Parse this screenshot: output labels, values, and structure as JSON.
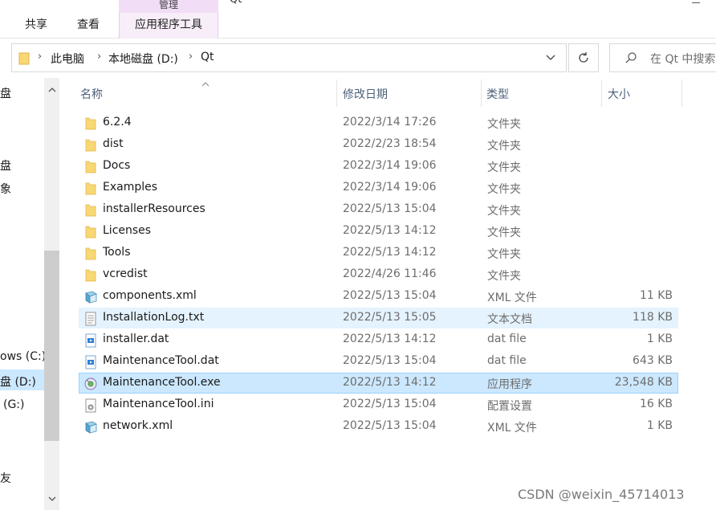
{
  "ribbon": {
    "manage_label": "管理",
    "window_title": "Qt",
    "tabs": [
      {
        "label": "共享"
      },
      {
        "label": "查看"
      },
      {
        "label": "应用程序工具"
      }
    ]
  },
  "address": {
    "crumbs": [
      "此电脑",
      "本地磁盘 (D:)",
      "Qt"
    ],
    "search_placeholder": "在 Qt 中搜索"
  },
  "nav": {
    "items": [
      {
        "label": "盘"
      },
      {
        "label": "盘"
      },
      {
        "label": "象"
      },
      {
        "label": "ows (C:)"
      },
      {
        "label": "盘 (D:)"
      },
      {
        "label": "(G:)"
      },
      {
        "label": "友"
      }
    ]
  },
  "columns": {
    "name": "名称",
    "date": "修改日期",
    "type": "类型",
    "size": "大小"
  },
  "files": [
    {
      "name": "6.2.4",
      "date": "2022/3/14 17:26",
      "type": "文件夹",
      "size": "",
      "icon": "folder-icon"
    },
    {
      "name": "dist",
      "date": "2022/2/23 18:54",
      "type": "文件夹",
      "size": "",
      "icon": "folder-icon"
    },
    {
      "name": "Docs",
      "date": "2022/3/14 19:06",
      "type": "文件夹",
      "size": "",
      "icon": "folder-icon"
    },
    {
      "name": "Examples",
      "date": "2022/3/14 19:06",
      "type": "文件夹",
      "size": "",
      "icon": "folder-icon"
    },
    {
      "name": "installerResources",
      "date": "2022/5/13 15:04",
      "type": "文件夹",
      "size": "",
      "icon": "folder-icon"
    },
    {
      "name": "Licenses",
      "date": "2022/5/13 14:12",
      "type": "文件夹",
      "size": "",
      "icon": "folder-icon"
    },
    {
      "name": "Tools",
      "date": "2022/5/13 14:12",
      "type": "文件夹",
      "size": "",
      "icon": "folder-icon"
    },
    {
      "name": "vcredist",
      "date": "2022/4/26 11:46",
      "type": "文件夹",
      "size": "",
      "icon": "folder-icon"
    },
    {
      "name": "components.xml",
      "date": "2022/5/13 15:04",
      "type": "XML 文件",
      "size": "11 KB",
      "icon": "xml-file-icon"
    },
    {
      "name": "InstallationLog.txt",
      "date": "2022/5/13 15:05",
      "type": "文本文档",
      "size": "118 KB",
      "icon": "text-file-icon"
    },
    {
      "name": "installer.dat",
      "date": "2022/5/13 14:12",
      "type": "dat file",
      "size": "1 KB",
      "icon": "dat-file-icon"
    },
    {
      "name": "MaintenanceTool.dat",
      "date": "2022/5/13 15:04",
      "type": "dat file",
      "size": "643 KB",
      "icon": "dat-file-icon"
    },
    {
      "name": "MaintenanceTool.exe",
      "date": "2022/5/13 14:12",
      "type": "应用程序",
      "size": "23,548 KB",
      "icon": "exe-file-icon"
    },
    {
      "name": "MaintenanceTool.ini",
      "date": "2022/5/13 15:04",
      "type": "配置设置",
      "size": "16 KB",
      "icon": "ini-file-icon"
    },
    {
      "name": "network.xml",
      "date": "2022/5/13 15:04",
      "type": "XML 文件",
      "size": "1 KB",
      "icon": "xml-file-icon"
    }
  ],
  "hover_row": "InstallationLog.txt",
  "selected_row": "MaintenanceTool.exe",
  "watermark": "CSDN @weixin_45714013",
  "colors": {
    "selection": "#cce8ff",
    "hover": "#e5f3ff",
    "folder": "#f8d775",
    "manage_tab": "#f1ddf6"
  }
}
